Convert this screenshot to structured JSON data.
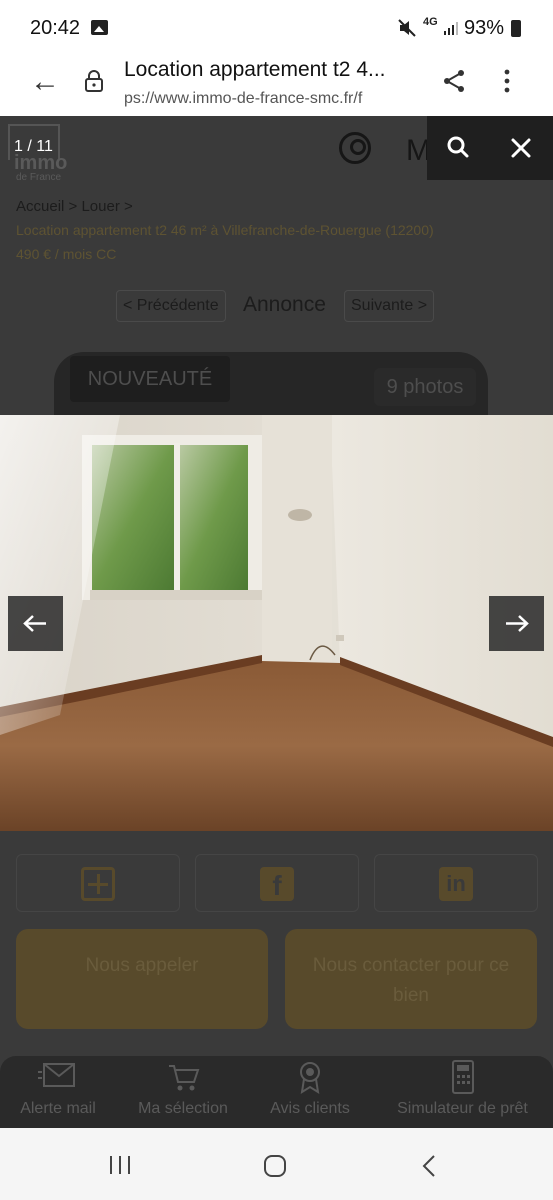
{
  "status_bar": {
    "time": "20:42",
    "network": "4G",
    "battery": "93%"
  },
  "browser": {
    "title": "Location appartement t2 4...",
    "url": "ps://www.immo-de-france-smc.fr/f"
  },
  "site": {
    "logo_text": "immo",
    "logo_sub": "de France",
    "menu_label": "MENU",
    "breadcrumb": "Accueil > Louer >",
    "listing_title": "Location appartement t2 46 m² à Villefranche-de-Rouergue (12200)",
    "listing_price": "490 € / mois CC",
    "nav_prev": "< Précédente",
    "nav_annonce": "Annonce",
    "nav_next": "Suivante >",
    "badge": "NOUVEAUTÉ",
    "photo_count": "9 photos",
    "cta_call": "Nous appeler",
    "cta_contact": "Nous contacter pour ce bien",
    "bottom_nav": [
      {
        "label": "Alerte mail",
        "icon": "mail-icon"
      },
      {
        "label": "Ma sélection",
        "icon": "cart-icon"
      },
      {
        "label": "Avis clients",
        "icon": "award-icon"
      },
      {
        "label": "Simulateur de prêt",
        "icon": "calculator-icon"
      }
    ]
  },
  "viewer": {
    "counter": "1 / 11"
  },
  "colors": {
    "accent_dim": "#584a2b",
    "overlay": "#3a3a3a"
  }
}
